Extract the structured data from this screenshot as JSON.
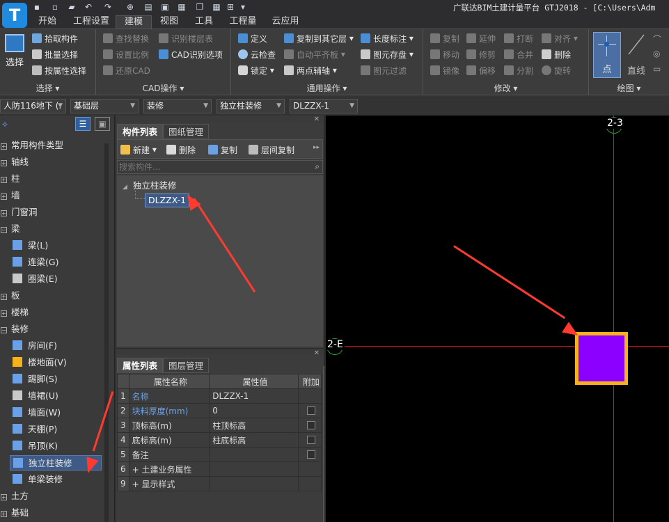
{
  "window": {
    "title": "广联达BIM土建计量平台 GTJ2018 - [C:\\Users\\Adm"
  },
  "tabs": [
    "开始",
    "工程设置",
    "建模",
    "视图",
    "工具",
    "工程量",
    "云应用"
  ],
  "active_tab": "建模",
  "ribbon": {
    "select": {
      "big": "选择",
      "items": [
        "拾取构件",
        "批量选择",
        "按属性选择"
      ],
      "label": "选择"
    },
    "cad": {
      "items": [
        "查找替换",
        "识别楼层表",
        "设置比例",
        "CAD识别选项",
        "还原CAD"
      ],
      "label": "CAD操作"
    },
    "general": {
      "items": [
        "定义",
        "复制到其它层",
        "长度标注",
        "云检查",
        "自动平齐板",
        "图元存盘",
        "锁定",
        "两点辅轴",
        "图元过滤"
      ],
      "label": "通用操作"
    },
    "modify": {
      "items": [
        "复制",
        "延伸",
        "打断",
        "对齐",
        "移动",
        "修剪",
        "合并",
        "删除",
        "镜像",
        "偏移",
        "分割",
        "旋转"
      ],
      "label": "修改"
    },
    "draw": {
      "point": "点",
      "line": "直线",
      "label": "绘图"
    }
  },
  "context_bar": {
    "floor": "人防116地下 (.",
    "layer": "基础层",
    "category": "装修",
    "type": "独立柱装修",
    "component": "DLZZX-1"
  },
  "left_tree": {
    "items": [
      {
        "label": "常用构件类型",
        "kind": "group"
      },
      {
        "label": "轴线",
        "kind": "group"
      },
      {
        "label": "柱",
        "kind": "group"
      },
      {
        "label": "墙",
        "kind": "group"
      },
      {
        "label": "门窗洞",
        "kind": "group"
      },
      {
        "label": "梁",
        "kind": "group-open"
      },
      {
        "label": "梁(L)",
        "kind": "child"
      },
      {
        "label": "连梁(G)",
        "kind": "child"
      },
      {
        "label": "圈梁(E)",
        "kind": "child"
      },
      {
        "label": "板",
        "kind": "group"
      },
      {
        "label": "楼梯",
        "kind": "group"
      },
      {
        "label": "装修",
        "kind": "group-open"
      },
      {
        "label": "房间(F)",
        "kind": "child"
      },
      {
        "label": "楼地面(V)",
        "kind": "child"
      },
      {
        "label": "踢脚(S)",
        "kind": "child"
      },
      {
        "label": "墙裙(U)",
        "kind": "child"
      },
      {
        "label": "墙面(W)",
        "kind": "child"
      },
      {
        "label": "天棚(P)",
        "kind": "child"
      },
      {
        "label": "吊顶(K)",
        "kind": "child"
      },
      {
        "label": "独立柱装修",
        "kind": "child-selected"
      },
      {
        "label": "单梁装修",
        "kind": "child"
      },
      {
        "label": "土方",
        "kind": "group"
      },
      {
        "label": "基础",
        "kind": "group"
      }
    ]
  },
  "component_panel": {
    "tabs": [
      "构件列表",
      "图纸管理"
    ],
    "toolbar": [
      "新建",
      "删除",
      "复制",
      "层间复制"
    ],
    "search_placeholder": "搜索构件...",
    "tree_parent": "独立柱装修",
    "tree_child": "DLZZX-1"
  },
  "property_panel": {
    "tabs": [
      "属性列表",
      "图层管理"
    ],
    "headers": [
      "属性名称",
      "属性值",
      "附加"
    ],
    "rows": [
      {
        "n": "1",
        "name": "名称",
        "value": "DLZZX-1",
        "blue": true,
        "check": false
      },
      {
        "n": "2",
        "name": "块料厚度(mm)",
        "value": "0",
        "blue": true,
        "check": true
      },
      {
        "n": "3",
        "name": "顶标高(m)",
        "value": "柱顶标高",
        "blue": false,
        "check": true
      },
      {
        "n": "4",
        "name": "底标高(m)",
        "value": "柱底标高",
        "blue": false,
        "check": true
      },
      {
        "n": "5",
        "name": "备注",
        "value": "",
        "blue": false,
        "check": true
      },
      {
        "n": "6",
        "name": "+ 土建业务属性",
        "value": "",
        "blue": false,
        "check": false
      },
      {
        "n": "9",
        "name": "+ 显示样式",
        "value": "",
        "blue": false,
        "check": false
      }
    ]
  },
  "canvas": {
    "axis_vertical": "2-3",
    "axis_horizontal": "2-E",
    "colors": {
      "fill": "#8b00ff",
      "border": "#f5b21b",
      "axis": "#e0141b",
      "arrow": "#ff3b30"
    }
  }
}
